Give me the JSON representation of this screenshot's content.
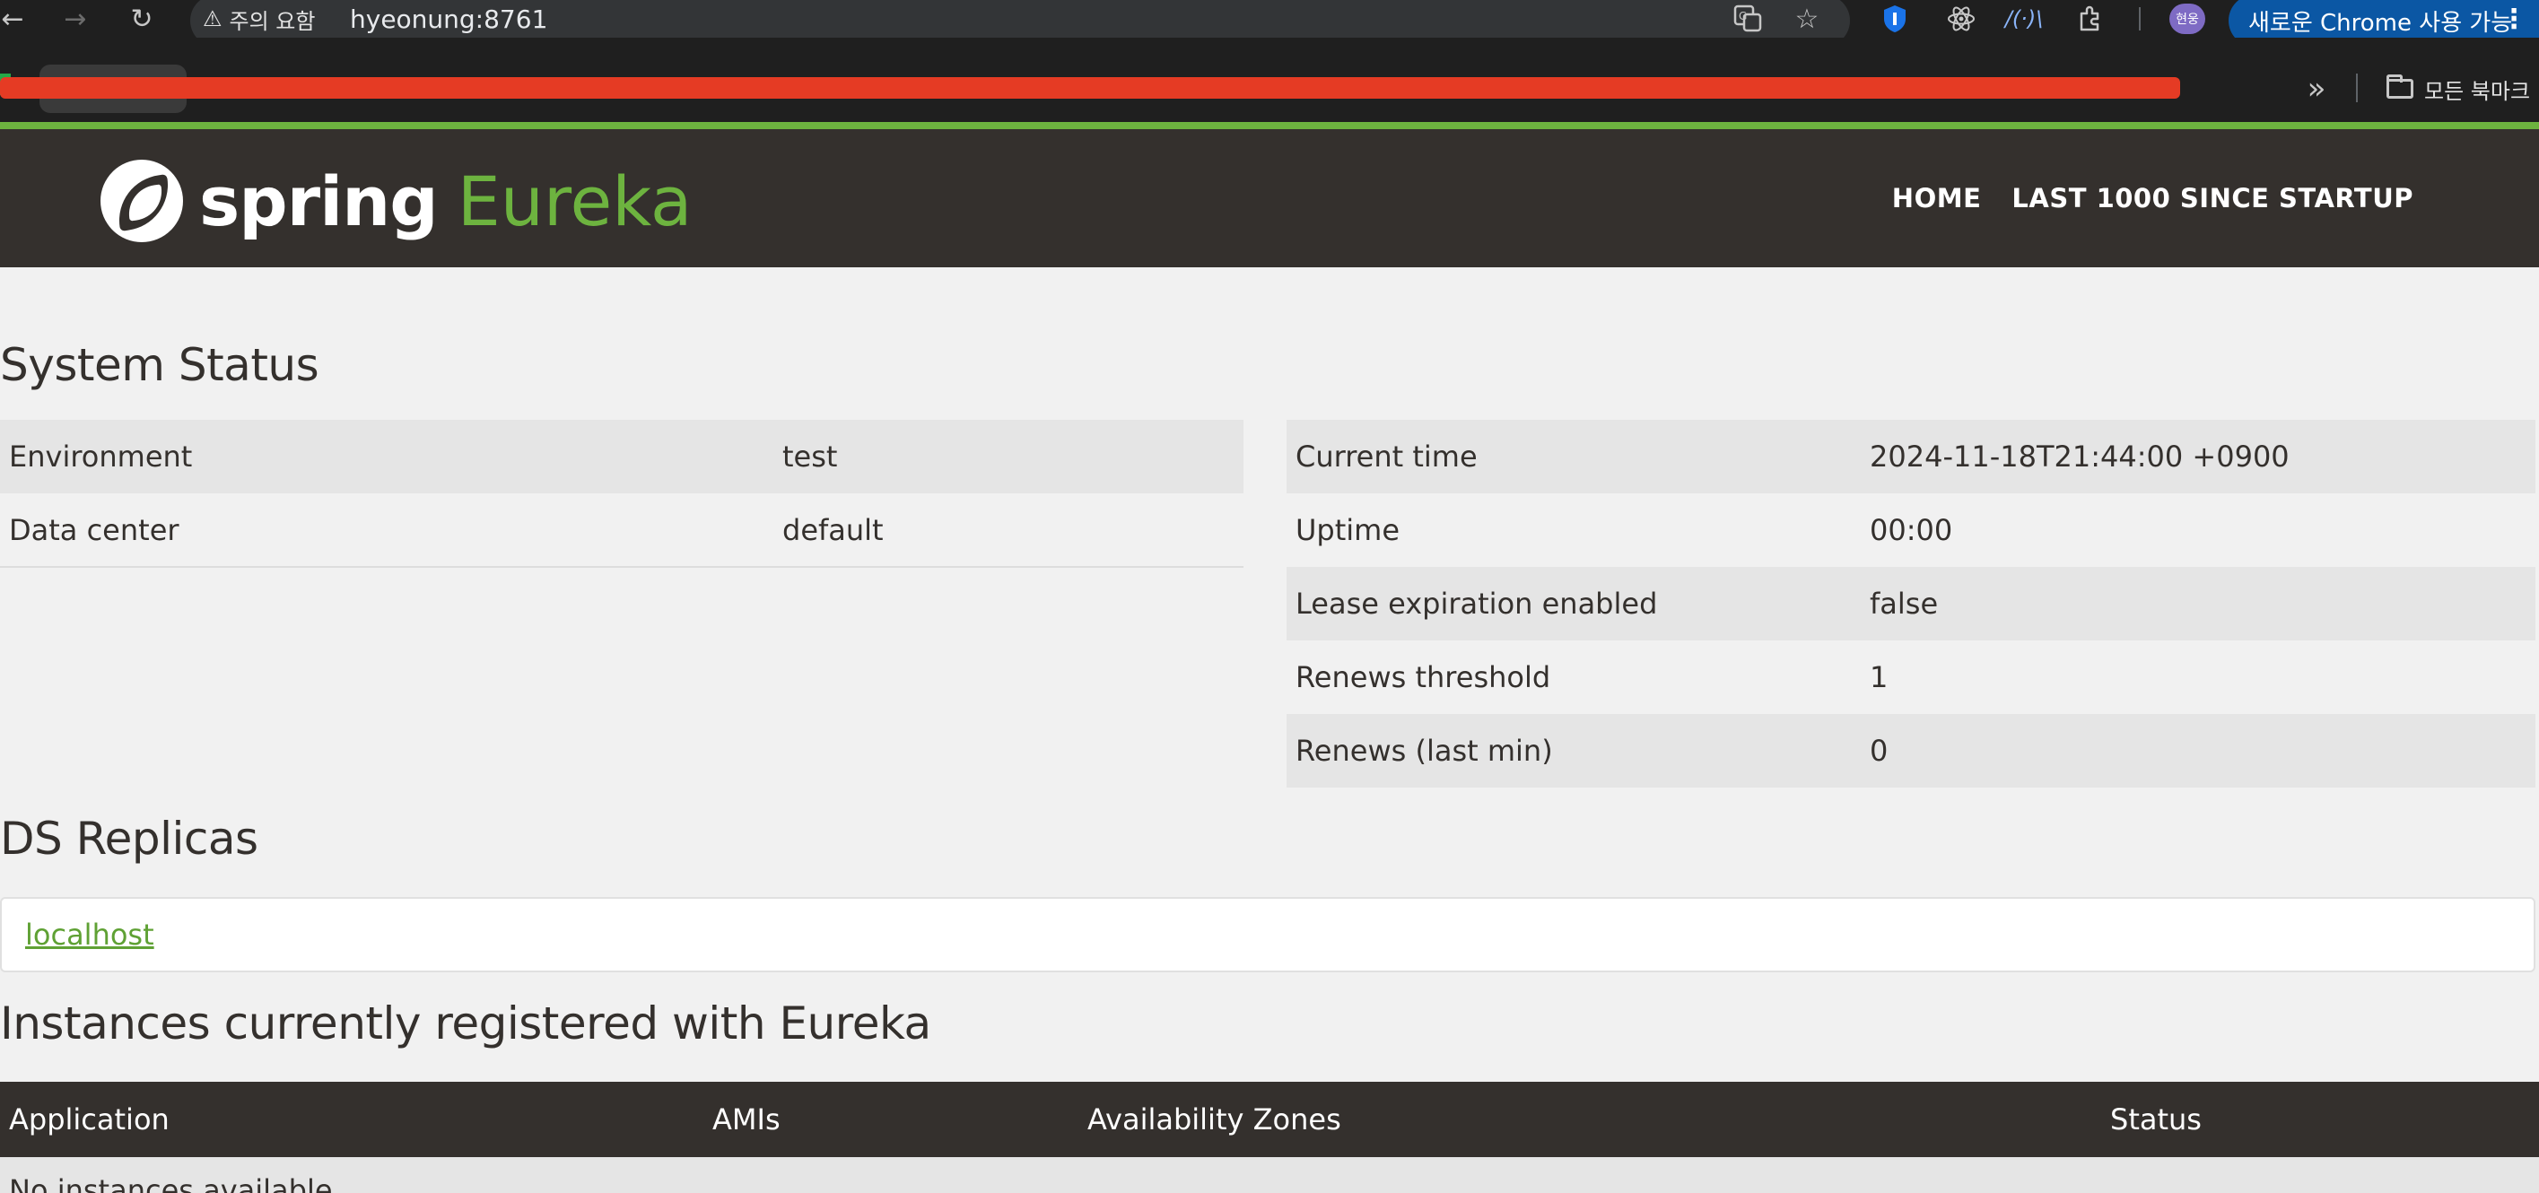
{
  "browser": {
    "security_label": "주의 요함",
    "url": "hyeonung:8761",
    "profile_initials": "현웅",
    "update_label": "새로운 Chrome 사용 가능",
    "all_bookmarks_label": "모든 북마크"
  },
  "navbar": {
    "logo_spring": "spring",
    "logo_eureka": "Eureka",
    "links": [
      "HOME",
      "LAST 1000 SINCE STARTUP"
    ]
  },
  "system_status": {
    "title": "System Status",
    "left": [
      {
        "label": "Environment",
        "value": "test"
      },
      {
        "label": "Data center",
        "value": "default"
      }
    ],
    "right": [
      {
        "label": "Current time",
        "value": "2024-11-18T21:44:00 +0900"
      },
      {
        "label": "Uptime",
        "value": "00:00"
      },
      {
        "label": "Lease expiration enabled",
        "value": "false"
      },
      {
        "label": "Renews threshold",
        "value": "1"
      },
      {
        "label": "Renews (last min)",
        "value": "0"
      }
    ]
  },
  "ds_replicas": {
    "title": "DS Replicas",
    "items": [
      "localhost"
    ]
  },
  "instances": {
    "title": "Instances currently registered with Eureka",
    "columns": [
      "Application",
      "AMIs",
      "Availability Zones",
      "Status"
    ],
    "empty_message": "No instances available"
  },
  "colors": {
    "spring_green": "#6db33f",
    "navbar_bg": "#34302d",
    "link_green": "#5fa134",
    "redaction_red": "#e53b24"
  }
}
